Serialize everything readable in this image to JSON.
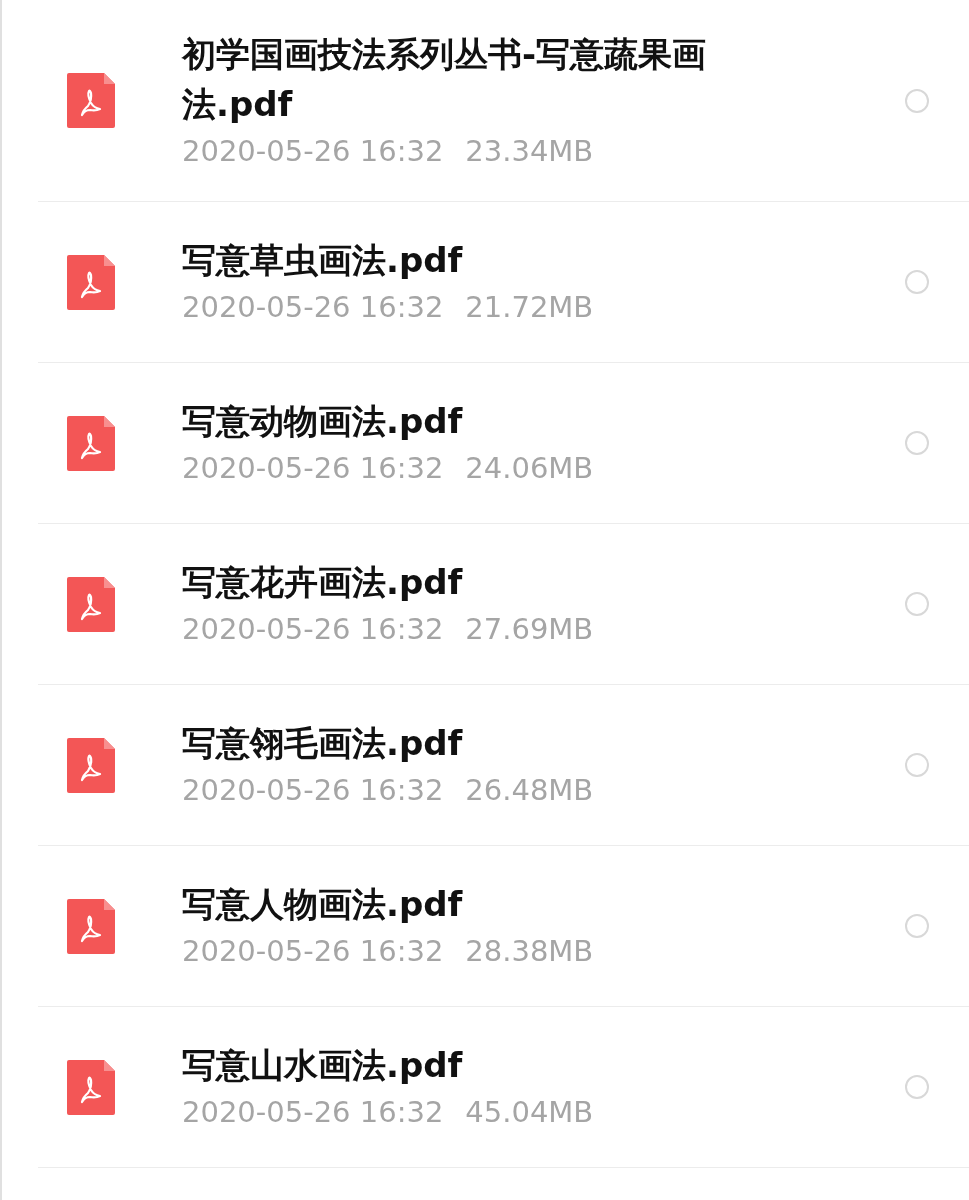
{
  "files": [
    {
      "name": "初学国画技法系列丛书-写意蔬果画法.pdf",
      "date": "2020-05-26  16:32",
      "size": "23.34MB",
      "selected": false
    },
    {
      "name": "写意草虫画法.pdf",
      "date": "2020-05-26  16:32",
      "size": "21.72MB",
      "selected": false
    },
    {
      "name": "写意动物画法.pdf",
      "date": "2020-05-26  16:32",
      "size": "24.06MB",
      "selected": false
    },
    {
      "name": "写意花卉画法.pdf",
      "date": "2020-05-26  16:32",
      "size": "27.69MB",
      "selected": false
    },
    {
      "name": "写意翎毛画法.pdf",
      "date": "2020-05-26  16:32",
      "size": "26.48MB",
      "selected": false
    },
    {
      "name": "写意人物画法.pdf",
      "date": "2020-05-26  16:32",
      "size": "28.38MB",
      "selected": false
    },
    {
      "name": "写意山水画法.pdf",
      "date": "2020-05-26  16:32",
      "size": "45.04MB",
      "selected": false
    }
  ]
}
